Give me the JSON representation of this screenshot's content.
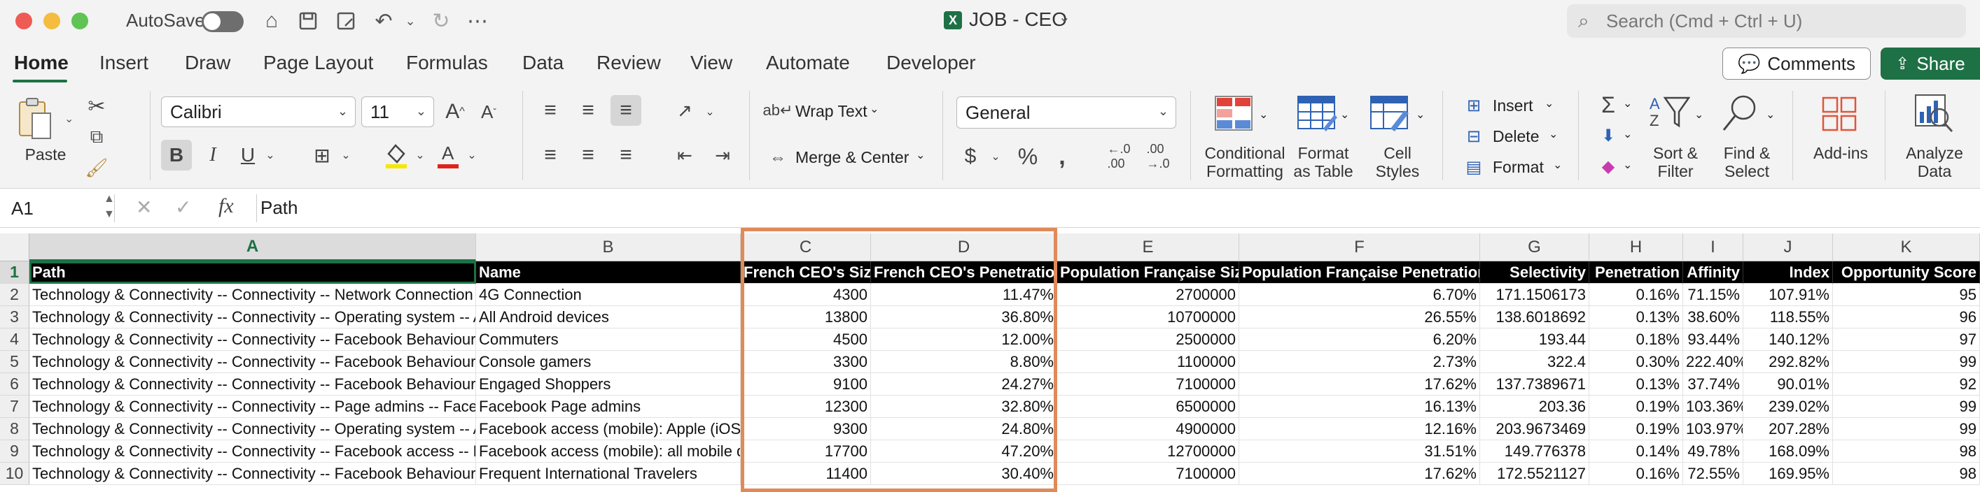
{
  "window": {
    "autosave_label": "AutoSave",
    "title": "JOB - CEO",
    "search_placeholder": "Search (Cmd + Ctrl + U)"
  },
  "menu": {
    "tabs": [
      "Home",
      "Insert",
      "Draw",
      "Page Layout",
      "Formulas",
      "Data",
      "Review",
      "View",
      "Automate",
      "Developer"
    ],
    "comments_label": "Comments",
    "share_label": "Share"
  },
  "ribbon": {
    "paste_label": "Paste",
    "font_name": "Calibri",
    "font_size": "11",
    "bold": "B",
    "italic": "I",
    "underline": "U",
    "wrap_text": "Wrap Text",
    "merge_center": "Merge & Center",
    "number_format": "General",
    "currency": "$",
    "percent": "%",
    "comma": ",",
    "conditional_formatting": [
      "Conditional",
      "Formatting"
    ],
    "format_as_table": [
      "Format",
      "as Table"
    ],
    "cell_styles": [
      "Cell",
      "Styles"
    ],
    "insert": "Insert",
    "delete": "Delete",
    "format": "Format",
    "sort_filter": [
      "Sort &",
      "Filter"
    ],
    "find_select": [
      "Find &",
      "Select"
    ],
    "addins": "Add-ins",
    "analyze_data": [
      "Analyze",
      "Data"
    ]
  },
  "formula_bar": {
    "name_box": "A1",
    "fx": "fx",
    "content": "Path"
  },
  "sheet": {
    "column_letters": [
      "A",
      "B",
      "C",
      "D",
      "E",
      "F",
      "G",
      "H",
      "I",
      "J",
      "K"
    ],
    "row_numbers": [
      "1",
      "2",
      "3",
      "4",
      "5",
      "6",
      "7",
      "8",
      "9",
      "10"
    ],
    "headers": [
      "Path",
      "Name",
      "French CEO's Size",
      "French CEO's Penetration",
      "Population Française Size",
      "Population Française Penetration",
      "Selectivity",
      "Penetration",
      "Affinity",
      "Index",
      "Opportunity Score"
    ],
    "rows": [
      [
        "Technology & Connectivity -- Connectivity -- Network Connection",
        "4G Connection",
        "4300",
        "11.47%",
        "2700000",
        "6.70%",
        "171.1506173",
        "0.16%",
        "71.15%",
        "107.91%",
        "95"
      ],
      [
        "Technology & Connectivity -- Connectivity -- Operating system -- A",
        "All Android devices",
        "13800",
        "36.80%",
        "10700000",
        "26.55%",
        "138.6018692",
        "0.13%",
        "38.60%",
        "118.55%",
        "96"
      ],
      [
        "Technology & Connectivity -- Connectivity -- Facebook Behaviours",
        "Commuters",
        "4500",
        "12.00%",
        "2500000",
        "6.20%",
        "193.44",
        "0.18%",
        "93.44%",
        "140.12%",
        "97"
      ],
      [
        "Technology & Connectivity -- Connectivity -- Facebook Behaviours",
        "Console gamers",
        "3300",
        "8.80%",
        "1100000",
        "2.73%",
        "322.4",
        "0.30%",
        "222.40%",
        "292.82%",
        "99"
      ],
      [
        "Technology & Connectivity -- Connectivity -- Facebook Behaviours",
        "Engaged Shoppers",
        "9100",
        "24.27%",
        "7100000",
        "17.62%",
        "137.7389671",
        "0.13%",
        "37.74%",
        "90.01%",
        "92"
      ],
      [
        "Technology & Connectivity -- Connectivity -- Page admins -- Faceb",
        "Facebook Page admins",
        "12300",
        "32.80%",
        "6500000",
        "16.13%",
        "203.36",
        "0.19%",
        "103.36%",
        "239.02%",
        "99"
      ],
      [
        "Technology & Connectivity -- Connectivity -- Operating system -- A",
        "Facebook access (mobile): Apple (iOS)",
        "9300",
        "24.80%",
        "4900000",
        "12.16%",
        "203.9673469",
        "0.19%",
        "103.97%",
        "207.28%",
        "99"
      ],
      [
        "Technology & Connectivity -- Connectivity -- Facebook access -- Fa",
        "Facebook access (mobile): all mobile d",
        "17700",
        "47.20%",
        "12700000",
        "31.51%",
        "149.776378",
        "0.14%",
        "49.78%",
        "168.09%",
        "98"
      ],
      [
        "Technology & Connectivity -- Connectivity -- Facebook Behaviours",
        "Frequent International Travelers",
        "11400",
        "30.40%",
        "7100000",
        "17.62%",
        "172.5521127",
        "0.16%",
        "72.55%",
        "169.95%",
        "98"
      ]
    ]
  },
  "colors": {
    "accent": "#1e7145",
    "highlight": "#e08a5a"
  }
}
